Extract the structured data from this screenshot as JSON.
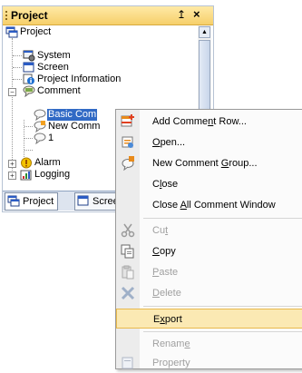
{
  "panel": {
    "title": "Project",
    "pin_glyph": "↥",
    "close_glyph": "×"
  },
  "tree": {
    "project": "Project",
    "system": "System",
    "screen": "Screen",
    "project_information": "Project Information",
    "comment": "Comment",
    "basic_comment": "Basic Com",
    "new_comment": "New Comm",
    "item_1": "1",
    "alarm": "Alarm",
    "logging": "Logging"
  },
  "tabs": {
    "project": "Project",
    "screen": "Scree"
  },
  "menu": {
    "add_comment_row": {
      "pre": "Add Comme",
      "key": "n",
      "post": "t Row..."
    },
    "open": {
      "pre": "",
      "key": "O",
      "post": "pen..."
    },
    "new_comment_group": {
      "pre": "New Comment ",
      "key": "G",
      "post": "roup..."
    },
    "close": {
      "pre": "C",
      "key": "l",
      "post": "ose"
    },
    "close_all": {
      "pre": "Close ",
      "key": "A",
      "post": "ll Comment Window"
    },
    "cut": {
      "pre": "Cu",
      "key": "t",
      "post": ""
    },
    "copy": {
      "pre": "",
      "key": "C",
      "post": "opy"
    },
    "paste": {
      "pre": "",
      "key": "P",
      "post": "aste"
    },
    "delete": {
      "pre": "",
      "key": "D",
      "post": "elete"
    },
    "export": {
      "pre": "E",
      "key": "x",
      "post": "port"
    },
    "rename": {
      "pre": "Renam",
      "key": "e",
      "post": ""
    },
    "property": {
      "pre": "Property",
      "key": "",
      "post": ""
    }
  },
  "colors": {
    "selection": "#316ac5",
    "menu_highlight": "#fbe9b3",
    "header": "#f6cf6a"
  },
  "icons": {
    "project": "project-icon",
    "system": "system-icon",
    "screen": "screen-icon",
    "info": "info-icon",
    "comment": "comment-icon",
    "alarm": "alarm-icon",
    "logging": "logging-icon"
  }
}
